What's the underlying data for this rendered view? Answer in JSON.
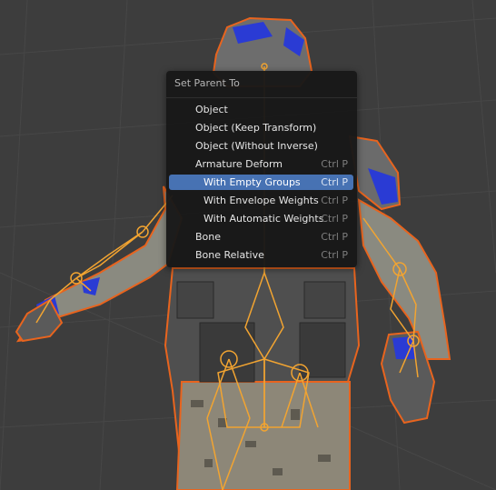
{
  "menu": {
    "title": "Set Parent To",
    "items": [
      {
        "label": "Object",
        "shortcut": ""
      },
      {
        "label": "Object (Keep Transform)",
        "shortcut": ""
      },
      {
        "label": "Object (Without Inverse)",
        "shortcut": ""
      },
      {
        "label": "Armature Deform",
        "shortcut": "Ctrl P"
      },
      {
        "label": "With Empty Groups",
        "shortcut": "Ctrl P",
        "active": true
      },
      {
        "label": "With Envelope Weights",
        "shortcut": "Ctrl P"
      },
      {
        "label": "With Automatic Weights",
        "shortcut": "Ctrl P"
      },
      {
        "label": "Bone",
        "shortcut": "Ctrl P"
      },
      {
        "label": "Bone Relative",
        "shortcut": "Ctrl P"
      }
    ]
  },
  "colors": {
    "viewport_bg": "#3d3d3d",
    "selection_outline": "#e8641e",
    "armature": "#f2a431",
    "highlight": "#4772b3",
    "armor_blue": "#2a3bd4"
  }
}
